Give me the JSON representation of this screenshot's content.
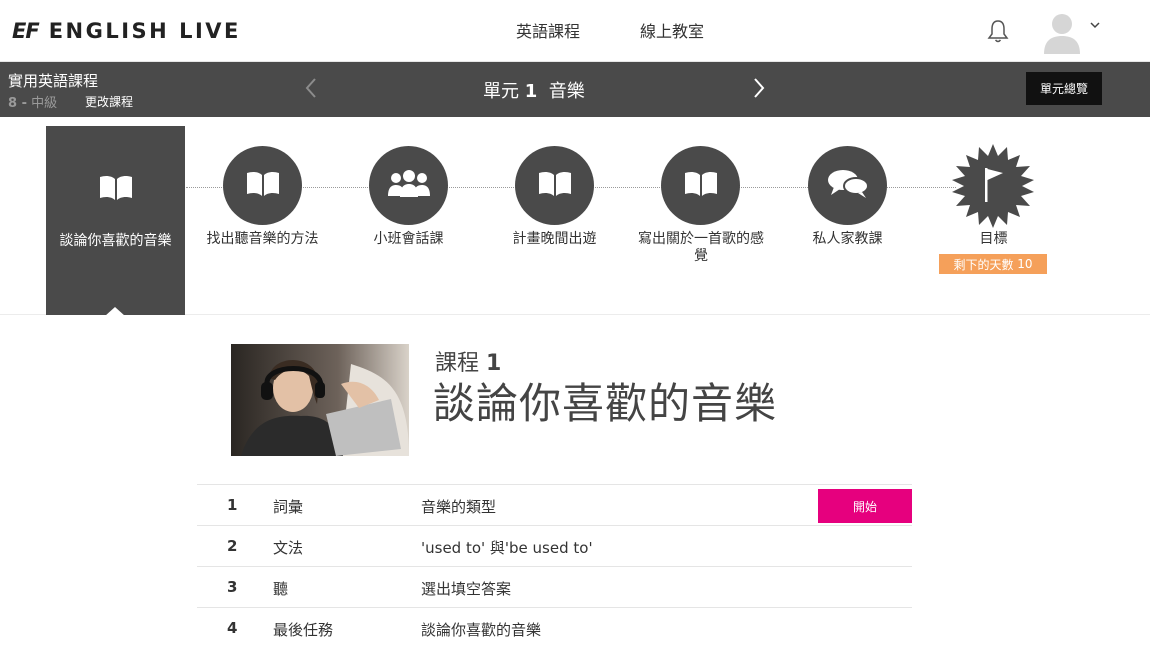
{
  "header": {
    "logo_ef": "EF",
    "logo_brand": "ENGLISH LIVE",
    "nav": [
      "英語課程",
      "線上教室"
    ],
    "icons": {
      "notifications": "bell-icon",
      "avatar": "user-avatar-icon",
      "menu": "chevron-down-icon"
    }
  },
  "unitbar": {
    "course_title": "實用英語課程",
    "level_number": "8 -",
    "level_name": "中級",
    "change_course": "更改課程",
    "unit_prefix": "單元",
    "unit_number": "1",
    "unit_name": "音樂",
    "overview_button": "單元總覽"
  },
  "steps": [
    {
      "label": "談論你喜歡的音樂",
      "icon": "book-icon",
      "active": true
    },
    {
      "label": "找出聽音樂的方法",
      "icon": "book-icon"
    },
    {
      "label": "小班會話課",
      "icon": "group-icon"
    },
    {
      "label": "計畫晚間出遊",
      "icon": "book-icon"
    },
    {
      "label": "寫出關於一首歌的感覺",
      "icon": "book-icon"
    },
    {
      "label": "私人家教課",
      "icon": "chat-bubbles-icon"
    },
    {
      "label": "目標",
      "icon": "flag-badge-icon"
    }
  ],
  "goal_badge": {
    "text": "剩下的天數",
    "days": "10"
  },
  "lesson": {
    "prefix": "課程",
    "number": "1",
    "title": "談論你喜歡的音樂"
  },
  "activities": [
    {
      "index": "1",
      "category": "詞彙",
      "description": "音樂的類型",
      "action": "開始"
    },
    {
      "index": "2",
      "category": "文法",
      "description": "'used to' 與'be used to'"
    },
    {
      "index": "3",
      "category": "聽",
      "description": "選出填空答案"
    },
    {
      "index": "4",
      "category": "最後任務",
      "description": "談論你喜歡的音樂"
    }
  ],
  "colors": {
    "dark_gray": "#4a4a4a",
    "pink_accent": "#e6007e",
    "orange_badge": "#f5a05a"
  }
}
